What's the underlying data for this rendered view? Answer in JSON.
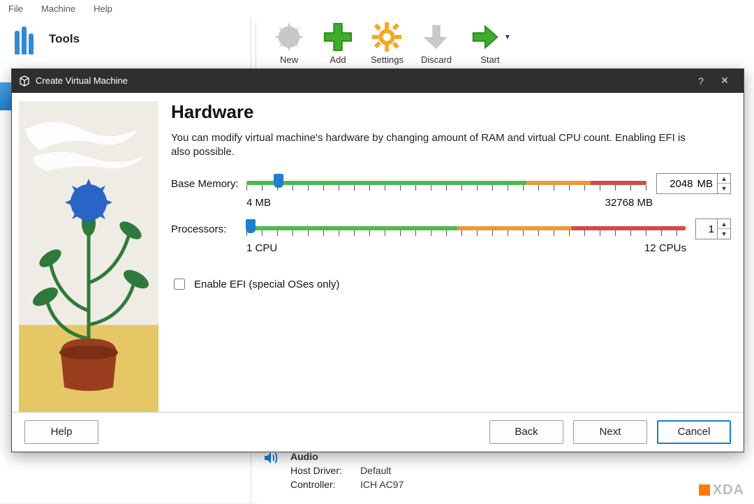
{
  "menubar": {
    "file": "File",
    "machine": "Machine",
    "help": "Help"
  },
  "sidebar": {
    "tools_label": "Tools"
  },
  "toolbar": {
    "new": "New",
    "add": "Add",
    "settings": "Settings",
    "discard": "Discard",
    "start": "Start"
  },
  "dialog": {
    "title": "Create Virtual Machine",
    "heading": "Hardware",
    "description": "You can modify virtual machine's hardware by changing amount of RAM and virtual CPU count. Enabling EFI is also possible.",
    "memory": {
      "label": "Base Memory:",
      "min_label": "4 MB",
      "max_label": "32768 MB",
      "value": "2048",
      "unit": "MB",
      "thumb_pct": 8
    },
    "processors": {
      "label": "Processors:",
      "min_label": "1 CPU",
      "max_label": "12 CPUs",
      "value": "1",
      "thumb_pct": 1
    },
    "efi": {
      "label": "Enable EFI (special OSes only)",
      "checked": false
    },
    "buttons": {
      "help": "Help",
      "back": "Back",
      "next": "Next",
      "cancel": "Cancel"
    }
  },
  "background": {
    "audio": {
      "title": "Audio",
      "host_driver_k": "Host Driver:",
      "host_driver_v": "Default",
      "controller_k": "Controller:",
      "controller_v": "ICH AC97"
    }
  },
  "watermark": "XDA"
}
